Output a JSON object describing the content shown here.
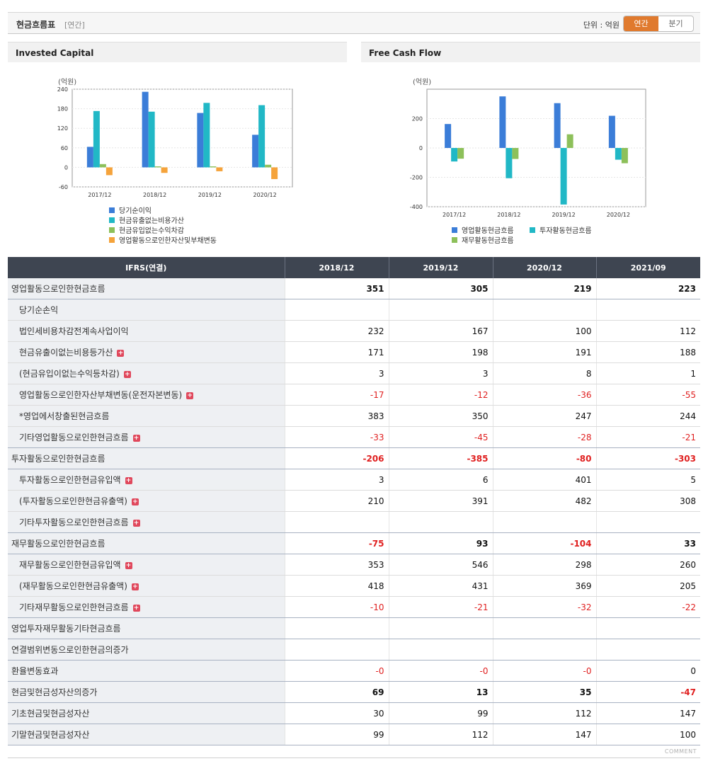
{
  "header": {
    "title": "현금흐름표",
    "period": "[연간]",
    "unit_label": "단위 : 억원",
    "toggle_annual": "연간",
    "toggle_quarter": "분기"
  },
  "colors": {
    "blue": "#3b7dd8",
    "cyan": "#21b8c6",
    "green": "#8dc05a",
    "orange": "#f5a33b",
    "neg": "#e02020"
  },
  "chart_data": [
    {
      "type": "bar",
      "title": "Invested Capital",
      "ylabel": "(억원)",
      "categories": [
        "2017/12",
        "2018/12",
        "2019/12",
        "2020/12"
      ],
      "ylim": [
        -60,
        240
      ],
      "yticks": [
        240,
        180,
        120,
        60,
        0,
        -60
      ],
      "series": [
        {
          "name": "당기순이익",
          "color": "#3b7dd8",
          "values": [
            63,
            232,
            167,
            100
          ]
        },
        {
          "name": "현금유출없는비용가산",
          "color": "#21b8c6",
          "values": [
            173,
            171,
            198,
            191
          ]
        },
        {
          "name": "현금유입없는수익차감",
          "color": "#8dc05a",
          "values": [
            10,
            3,
            3,
            8
          ]
        },
        {
          "name": "영업활동으로인한자산및부채변동",
          "color": "#f5a33b",
          "values": [
            -24,
            -17,
            -12,
            -36
          ]
        }
      ]
    },
    {
      "type": "bar",
      "title": "Free Cash Flow",
      "ylabel": "(억원)",
      "categories": [
        "2017/12",
        "2018/12",
        "2019/12",
        "2020/12"
      ],
      "ylim": [
        -400,
        400
      ],
      "yticks": [
        200,
        0,
        -200,
        -400
      ],
      "series": [
        {
          "name": "영업활동현금흐름",
          "color": "#3b7dd8",
          "values": [
            163,
            351,
            305,
            219
          ]
        },
        {
          "name": "투자활동현금흐름",
          "color": "#21b8c6",
          "values": [
            -92,
            -206,
            -385,
            -80
          ]
        },
        {
          "name": "재무활동현금흐름",
          "color": "#8dc05a",
          "values": [
            -73,
            -75,
            93,
            -104
          ]
        }
      ]
    }
  ],
  "table": {
    "header": [
      "IFRS(연결)",
      "2018/12",
      "2019/12",
      "2020/12",
      "2021/09"
    ],
    "rows": [
      {
        "label": "영업활동으로인한현금흐름",
        "level": 0,
        "plus": false,
        "bold": true,
        "values": [
          "351",
          "305",
          "219",
          "223"
        ]
      },
      {
        "label": "당기순손익",
        "level": 1,
        "plus": false,
        "bold": false,
        "values": [
          "",
          "",
          "",
          ""
        ]
      },
      {
        "label": "법인세비용차감전계속사업이익",
        "level": 1,
        "plus": false,
        "bold": false,
        "values": [
          "232",
          "167",
          "100",
          "112"
        ]
      },
      {
        "label": "현금유출이없는비용등가산",
        "level": 1,
        "plus": true,
        "bold": false,
        "values": [
          "171",
          "198",
          "191",
          "188"
        ]
      },
      {
        "label": "(현금유입이없는수익등차감)",
        "level": 1,
        "plus": true,
        "bold": false,
        "values": [
          "3",
          "3",
          "8",
          "1"
        ]
      },
      {
        "label": "영업활동으로인한자산부채변동(운전자본변동)",
        "level": 1,
        "plus": true,
        "bold": false,
        "values": [
          "-17",
          "-12",
          "-36",
          "-55"
        ]
      },
      {
        "label": "*영업에서창출된현금흐름",
        "level": 1,
        "plus": false,
        "bold": false,
        "values": [
          "383",
          "350",
          "247",
          "244"
        ]
      },
      {
        "label": "기타영업활동으로인한현금흐름",
        "level": 1,
        "plus": true,
        "bold": false,
        "values": [
          "-33",
          "-45",
          "-28",
          "-21"
        ]
      },
      {
        "label": "투자활동으로인한현금흐름",
        "level": 0,
        "plus": false,
        "bold": true,
        "values": [
          "-206",
          "-385",
          "-80",
          "-303"
        ]
      },
      {
        "label": "투자활동으로인한현금유입액",
        "level": 1,
        "plus": true,
        "bold": false,
        "values": [
          "3",
          "6",
          "401",
          "5"
        ]
      },
      {
        "label": "(투자활동으로인한현금유출액)",
        "level": 1,
        "plus": true,
        "bold": false,
        "values": [
          "210",
          "391",
          "482",
          "308"
        ]
      },
      {
        "label": "기타투자활동으로인한현금흐름",
        "level": 1,
        "plus": true,
        "bold": false,
        "values": [
          "",
          "",
          "",
          ""
        ]
      },
      {
        "label": "재무활동으로인한현금흐름",
        "level": 0,
        "plus": false,
        "bold": true,
        "values": [
          "-75",
          "93",
          "-104",
          "33"
        ]
      },
      {
        "label": "재무활동으로인한현금유입액",
        "level": 1,
        "plus": true,
        "bold": false,
        "values": [
          "353",
          "546",
          "298",
          "260"
        ]
      },
      {
        "label": "(재무활동으로인한현금유출액)",
        "level": 1,
        "plus": true,
        "bold": false,
        "values": [
          "418",
          "431",
          "369",
          "205"
        ]
      },
      {
        "label": "기타재무활동으로인한현금흐름",
        "level": 1,
        "plus": true,
        "bold": false,
        "values": [
          "-10",
          "-21",
          "-32",
          "-22"
        ]
      },
      {
        "label": "영업투자재무활동기타현금흐름",
        "level": 0,
        "plus": false,
        "bold": false,
        "values": [
          "",
          "",
          "",
          ""
        ]
      },
      {
        "label": "연결범위변동으로인한현금의증가",
        "level": 0,
        "plus": false,
        "bold": false,
        "values": [
          "",
          "",
          "",
          ""
        ]
      },
      {
        "label": "환율변동효과",
        "level": 0,
        "plus": false,
        "bold": false,
        "values": [
          "-0",
          "-0",
          "-0",
          "0"
        ]
      },
      {
        "label": "현금및현금성자산의증가",
        "level": 0,
        "plus": false,
        "bold": true,
        "values": [
          "69",
          "13",
          "35",
          "-47"
        ]
      },
      {
        "label": "기초현금및현금성자산",
        "level": 0,
        "plus": false,
        "bold": false,
        "values": [
          "30",
          "99",
          "112",
          "147"
        ]
      },
      {
        "label": "기말현금및현금성자산",
        "level": 0,
        "plus": false,
        "bold": false,
        "values": [
          "99",
          "112",
          "147",
          "100"
        ]
      }
    ]
  },
  "footer": {
    "comment": "COMMENT"
  }
}
